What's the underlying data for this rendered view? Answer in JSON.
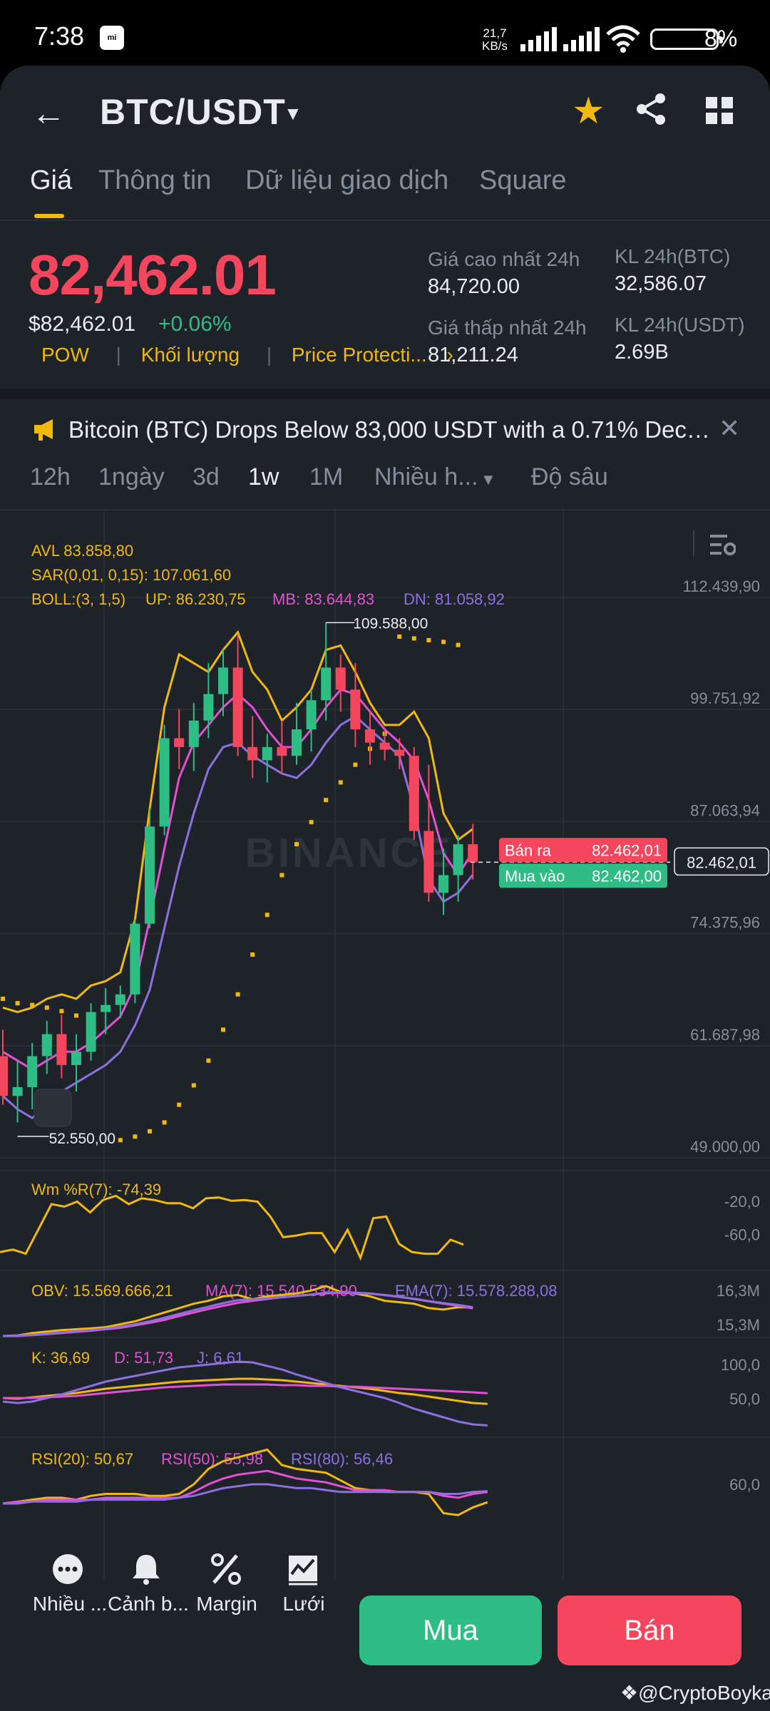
{
  "status_bar": {
    "time": "7:38",
    "mi_label": "mi",
    "speed_value": "21,7",
    "speed_unit": "KB/s",
    "battery": "8%"
  },
  "header": {
    "pair": "BTC/USDT"
  },
  "tabs": [
    "Giá",
    "Thông tin",
    "Dữ liệu giao dịch",
    "Square"
  ],
  "price": {
    "last": "82,462.01",
    "usd": "$82,462.01",
    "change": "+0.06%",
    "tags": [
      "POW",
      "Khối lượng",
      "Price Protecti..."
    ],
    "high_label": "Giá cao nhất 24h",
    "high": "84,720.00",
    "low_label": "Giá thấp nhất 24h",
    "low": "81,211.24",
    "vol_btc_label": "KL 24h(BTC)",
    "vol_btc": "32,586.07",
    "vol_usdt_label": "KL 24h(USDT)",
    "vol_usdt": "2.69B"
  },
  "news": {
    "text": "Bitcoin (BTC) Drops Below 83,000 USDT with a 0.71% Decre..."
  },
  "timeframes": [
    "12h",
    "1ngày",
    "3d",
    "1w",
    "1M",
    "Nhiều h...",
    "Độ sâu"
  ],
  "active_timeframe": "1w",
  "chart_data": {
    "type": "candlestick",
    "indicators": {
      "avl": "AVL 83.858,80",
      "sar": "SAR(0,01, 0,15): 107.061,60",
      "boll_params": "BOLL:(3, 1,5)",
      "boll_up": "UP: 86.230,75",
      "boll_mb": "MB: 83.644,83",
      "boll_dn": "DN: 81.058,92"
    },
    "y_ticks": [
      "112.439,90",
      "99.751,92",
      "87.063,94",
      "74.375,96",
      "61.687,98",
      "49.000,00"
    ],
    "ylim": [
      49000,
      112439.9
    ],
    "max_label": "109.588,00",
    "min_label": "52.550,00",
    "sell_label": "Bán ra",
    "sell_price": "82.462,01",
    "buy_label": "Mua vào",
    "buy_price": "82.462,00",
    "current_price_tag": "82.462,01",
    "watermark": "BINANCE",
    "candles": [
      {
        "o": 60500,
        "h": 63500,
        "l": 55000,
        "c": 56000
      },
      {
        "o": 56000,
        "h": 60000,
        "l": 53000,
        "c": 57000
      },
      {
        "o": 57000,
        "h": 62000,
        "l": 54500,
        "c": 60500
      },
      {
        "o": 60500,
        "h": 64500,
        "l": 58500,
        "c": 63000
      },
      {
        "o": 63000,
        "h": 65200,
        "l": 58000,
        "c": 59500
      },
      {
        "o": 59500,
        "h": 63000,
        "l": 56500,
        "c": 61000
      },
      {
        "o": 61000,
        "h": 66500,
        "l": 60000,
        "c": 65500
      },
      {
        "o": 65500,
        "h": 68200,
        "l": 63000,
        "c": 66300
      },
      {
        "o": 66300,
        "h": 68500,
        "l": 64800,
        "c": 67500
      },
      {
        "o": 67500,
        "h": 76000,
        "l": 66500,
        "c": 75500
      },
      {
        "o": 75500,
        "h": 88500,
        "l": 75000,
        "c": 86500
      },
      {
        "o": 86500,
        "h": 98000,
        "l": 85500,
        "c": 96500
      },
      {
        "o": 96500,
        "h": 99800,
        "l": 93000,
        "c": 95500
      },
      {
        "o": 95500,
        "h": 100500,
        "l": 92800,
        "c": 98500
      },
      {
        "o": 98500,
        "h": 105000,
        "l": 96500,
        "c": 101500
      },
      {
        "o": 101500,
        "h": 106500,
        "l": 99000,
        "c": 104500
      },
      {
        "o": 104500,
        "h": 108300,
        "l": 94500,
        "c": 95500
      },
      {
        "o": 95500,
        "h": 99000,
        "l": 92000,
        "c": 94000
      },
      {
        "o": 94000,
        "h": 97000,
        "l": 91500,
        "c": 95500
      },
      {
        "o": 95500,
        "h": 98500,
        "l": 92500,
        "c": 94500
      },
      {
        "o": 94500,
        "h": 100500,
        "l": 93500,
        "c": 97500
      },
      {
        "o": 97500,
        "h": 102000,
        "l": 95000,
        "c": 100800
      },
      {
        "o": 100800,
        "h": 109588,
        "l": 98500,
        "c": 104500
      },
      {
        "o": 104500,
        "h": 106000,
        "l": 99500,
        "c": 102000
      },
      {
        "o": 102000,
        "h": 105000,
        "l": 95500,
        "c": 97500
      },
      {
        "o": 97500,
        "h": 99500,
        "l": 93500,
        "c": 96000
      },
      {
        "o": 96000,
        "h": 97500,
        "l": 94000,
        "c": 95200
      },
      {
        "o": 95200,
        "h": 96500,
        "l": 93000,
        "c": 94500
      },
      {
        "o": 94500,
        "h": 95500,
        "l": 85000,
        "c": 86000
      },
      {
        "o": 86000,
        "h": 93500,
        "l": 78000,
        "c": 79000
      },
      {
        "o": 79000,
        "h": 84000,
        "l": 76500,
        "c": 81000
      },
      {
        "o": 81000,
        "h": 85500,
        "l": 78000,
        "c": 84500
      },
      {
        "o": 84500,
        "h": 86800,
        "l": 80500,
        "c": 82462
      }
    ],
    "boll_upper": [
      66000,
      65500,
      66000,
      67000,
      67500,
      67000,
      68500,
      69000,
      70000,
      76000,
      88500,
      100000,
      106000,
      105000,
      104000,
      106500,
      108500,
      104000,
      102000,
      98500,
      100000,
      102000,
      106500,
      107000,
      104000,
      100500,
      98000,
      98000,
      99500,
      96500,
      88000,
      85000,
      86230
    ],
    "boll_mid": [
      61000,
      60000,
      59000,
      60000,
      61000,
      61000,
      62000,
      63500,
      65000,
      68500,
      76000,
      84000,
      92000,
      96000,
      98000,
      100000,
      101500,
      100000,
      97500,
      95500,
      95500,
      97500,
      100000,
      102000,
      101500,
      99500,
      97500,
      96000,
      94000,
      89500,
      83500,
      81000,
      83644
    ],
    "boll_lower": [
      56000,
      54500,
      53500,
      55000,
      56500,
      57500,
      58500,
      59500,
      61000,
      64000,
      68000,
      75000,
      82000,
      88000,
      93000,
      95500,
      96000,
      94500,
      93500,
      92500,
      92000,
      93500,
      96000,
      98000,
      99000,
      97500,
      96000,
      94500,
      88500,
      80500,
      78000,
      79000,
      81058
    ],
    "sar": [
      67000,
      66500,
      66300,
      66000,
      65600,
      65100,
      64600,
      null,
      51000,
      51400,
      52000,
      53000,
      55000,
      57200,
      60000,
      63500,
      67500,
      72000,
      76500,
      81000,
      84500,
      87000,
      89500,
      91500,
      93500,
      95300,
      97000,
      108000,
      107800,
      107600,
      107400,
      107061
    ],
    "wr_ticks": [
      "-20,0",
      "-60,0"
    ],
    "wr_label": "Wm %R(7): -74,39",
    "wr": [
      -83,
      -80,
      -85,
      -55,
      -25,
      -28,
      -22,
      -35,
      -20,
      -15,
      -25,
      -18,
      -20,
      -24,
      -24,
      -30,
      -18,
      -17,
      -21,
      -20,
      -22,
      -40,
      -65,
      -63,
      -60,
      -60,
      -83,
      -56,
      -90,
      -42,
      -40,
      -73,
      -83,
      -85,
      -85,
      -68,
      -74
    ],
    "obv_label": "OBV: 15.569.666,21",
    "obv_ma_label": "MA(7): 15.540.534,90",
    "obv_ema_label": "EMA(7): 15.578.288,08",
    "obv_ticks": [
      "16,3M",
      "15,3M"
    ],
    "obv": [
      14.6,
      14.62,
      14.7,
      14.75,
      14.8,
      14.83,
      14.86,
      14.9,
      15.0,
      15.1,
      15.25,
      15.4,
      15.55,
      15.7,
      15.8,
      15.95,
      16.0,
      15.85,
      15.95,
      16.0,
      16.05,
      16.15,
      16.3,
      16.1,
      16.05,
      15.95,
      15.8,
      15.75,
      15.7,
      15.55,
      15.5,
      15.58,
      15.57
    ],
    "obv_ma": [
      14.6,
      14.6,
      14.63,
      14.66,
      14.7,
      14.74,
      14.78,
      14.83,
      14.88,
      14.96,
      15.05,
      15.15,
      15.28,
      15.4,
      15.52,
      15.63,
      15.73,
      15.8,
      15.86,
      15.92,
      15.97,
      16.01,
      16.05,
      16.07,
      16.06,
      16.04,
      16.0,
      15.94,
      15.86,
      15.78,
      15.7,
      15.63,
      15.54
    ],
    "obv_ema": [
      14.6,
      14.61,
      14.64,
      14.68,
      14.72,
      14.76,
      14.8,
      14.85,
      14.92,
      15.0,
      15.1,
      15.22,
      15.35,
      15.48,
      15.6,
      15.72,
      15.82,
      15.85,
      15.88,
      15.92,
      15.96,
      16.01,
      16.08,
      16.09,
      16.08,
      16.05,
      15.99,
      15.93,
      15.87,
      15.79,
      15.72,
      15.66,
      15.58
    ],
    "kdj_label_k": "K: 36,69",
    "kdj_label_d": "D: 51,73",
    "kdj_label_j": "J: 6,61",
    "kdj_ticks": [
      "100,0",
      "50,0"
    ],
    "kdj_k": [
      45,
      44,
      46,
      48,
      50,
      52,
      55,
      58,
      60,
      62,
      64,
      66,
      68,
      69,
      70,
      71,
      72,
      72,
      71,
      70,
      68,
      66,
      64,
      62,
      60,
      58,
      55,
      52,
      50,
      47,
      44,
      41,
      38,
      36.69
    ],
    "kdj_d": [
      45,
      45,
      45,
      46,
      47,
      48,
      50,
      52,
      54,
      56,
      58,
      60,
      61,
      62,
      63,
      64,
      64,
      64,
      64,
      63,
      63,
      62,
      62,
      61,
      61,
      60,
      59,
      58,
      57,
      56,
      55,
      54,
      53,
      51.73
    ],
    "kdj_j": [
      40,
      38,
      40,
      45,
      50,
      56,
      62,
      68,
      72,
      76,
      80,
      84,
      88,
      90,
      92,
      94,
      96,
      95,
      90,
      85,
      78,
      72,
      66,
      60,
      55,
      50,
      45,
      38,
      30,
      24,
      18,
      12,
      8,
      6.61
    ],
    "rsi_label_20": "RSI(20): 50,67",
    "rsi_label_50": "RSI(50): 55,98",
    "rsi_label_80": "RSI(80): 56,46",
    "rsi_ticks": [
      "60,0"
    ],
    "rsi20": [
      50,
      51,
      52,
      53,
      53,
      52,
      54,
      55,
      55,
      55,
      54,
      54,
      55,
      60,
      68,
      72,
      74,
      76,
      78,
      70,
      68,
      67,
      66,
      62,
      58,
      57,
      56,
      56,
      56,
      55,
      45,
      44,
      48,
      50.67
    ],
    "rsi50": [
      50,
      51,
      51,
      52,
      52,
      52,
      52,
      53,
      53,
      53,
      53,
      53,
      53,
      56,
      60,
      63,
      65,
      66,
      67,
      65,
      63,
      62,
      61,
      59,
      57,
      57,
      57,
      56,
      56,
      56,
      54,
      53,
      55,
      55.98
    ],
    "rsi80": [
      50,
      50,
      51,
      51,
      51,
      51,
      52,
      52,
      52,
      52,
      52,
      52,
      53,
      54,
      56,
      58,
      59,
      60,
      60,
      59,
      58,
      58,
      57,
      56,
      56,
      56,
      56,
      56,
      56,
      56,
      55,
      55,
      56,
      56.46
    ]
  },
  "bottom_bar": {
    "more": "Nhiều ...",
    "alert": "Cảnh b...",
    "margin": "Margin",
    "grid": "Lưới",
    "buy": "Mua",
    "sell": "Bán"
  },
  "watermark_user": "@CryptoBoyka",
  "colors": {
    "bg": "#1E2329",
    "up": "#2EBD85",
    "down": "#F6465D",
    "accent": "#F0B90B",
    "boll_mb": "#E450D2",
    "boll_dn": "#8E6FE0"
  }
}
